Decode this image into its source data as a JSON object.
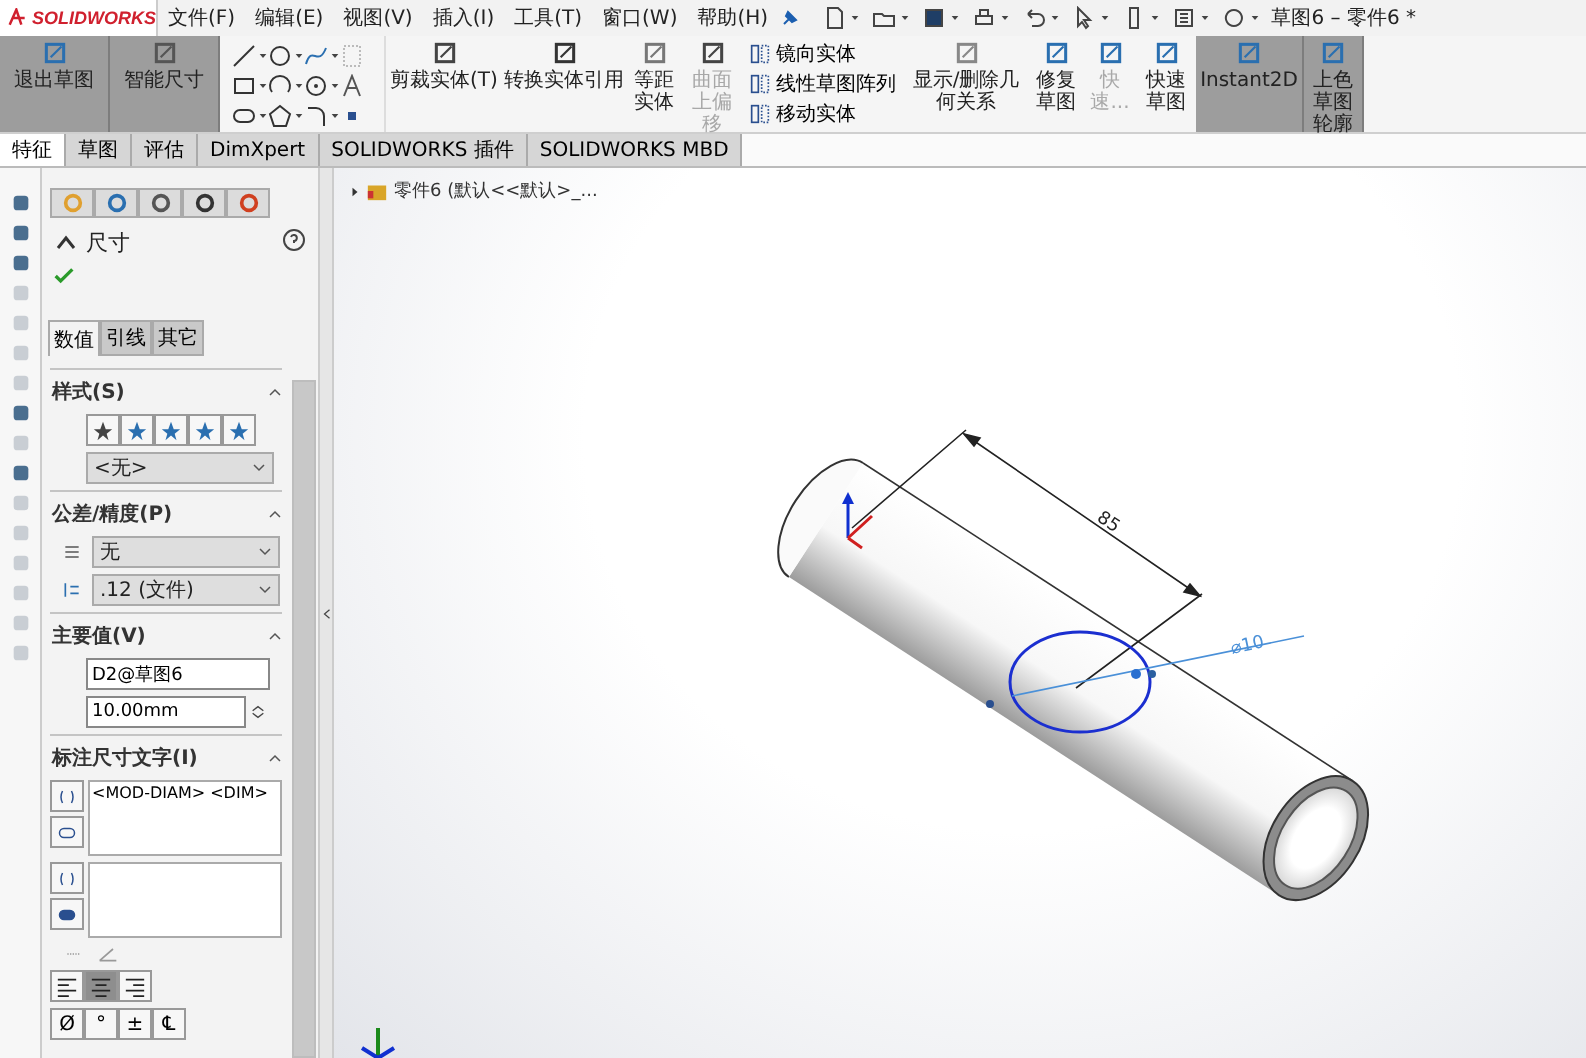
{
  "app": {
    "logo": "SOLIDWORKS",
    "menu": [
      "文件(F)",
      "编辑(E)",
      "视图(V)",
      "插入(I)",
      "工具(T)",
      "窗口(W)",
      "帮助(H)"
    ],
    "title": "草图6 – 零件6 *"
  },
  "ribbon": [
    {
      "kind": "large",
      "label": "退出草图",
      "selected": true,
      "disabled": false
    },
    {
      "kind": "large",
      "label": "智能尺寸",
      "selected": true,
      "disabled": false
    },
    {
      "kind": "tools"
    },
    {
      "kind": "large",
      "label": "剪裁实体(T)",
      "selected": false,
      "disabled": false
    },
    {
      "kind": "large",
      "label": "转换实体引用",
      "selected": false,
      "disabled": false
    },
    {
      "kind": "large",
      "label": "等距实体",
      "selected": false,
      "disabled": false
    },
    {
      "kind": "large",
      "label": "曲面上偏移",
      "selected": false,
      "disabled": true
    },
    {
      "kind": "stack",
      "items": [
        "镜向实体",
        "线性草图阵列",
        "移动实体"
      ]
    },
    {
      "kind": "large",
      "label": "显示/删除几何关系",
      "selected": false,
      "disabled": false
    },
    {
      "kind": "large",
      "label": "修复草图",
      "selected": false,
      "disabled": false
    },
    {
      "kind": "large",
      "label": "快速...",
      "selected": false,
      "disabled": true
    },
    {
      "kind": "large",
      "label": "快速草图",
      "selected": false,
      "disabled": false
    },
    {
      "kind": "large",
      "label": "Instant2D",
      "selected": true,
      "disabled": false
    },
    {
      "kind": "large",
      "label": "上色草图轮廓",
      "selected": true,
      "disabled": false
    }
  ],
  "tabs": [
    {
      "label": "特征",
      "selected": true
    },
    {
      "label": "草图",
      "selected": false
    },
    {
      "label": "评估",
      "selected": false
    },
    {
      "label": "DimXpert",
      "selected": false
    },
    {
      "label": "SOLIDWORKS 插件",
      "selected": false
    },
    {
      "label": "SOLIDWORKS MBD",
      "selected": false
    }
  ],
  "property_manager": {
    "title": "尺寸",
    "tabs": [
      {
        "label": "数值",
        "selected": true
      },
      {
        "label": "引线",
        "selected": false
      },
      {
        "label": "其它",
        "selected": false
      }
    ],
    "style": {
      "header": "样式(S)",
      "dropdown": "<无>"
    },
    "tolerance": {
      "header": "公差/精度(P)",
      "type": "无",
      "precision": ".12 (文件)"
    },
    "primary": {
      "header": "主要值(V)",
      "name": "D2@草图6",
      "value": "10.00mm"
    },
    "dimension_text": {
      "header": "标注尺寸文字(I)",
      "text": "<MOD-DIAM> <DIM>",
      "alignment": [
        {
          "selected": false
        },
        {
          "selected": true
        },
        {
          "selected": false
        }
      ],
      "symbols": [
        "Ø",
        "°",
        "±",
        "℄"
      ]
    }
  },
  "viewport": {
    "tree_item": "零件6 (默认<<默认>_...",
    "dimension": "85",
    "diameter": "⌀10"
  }
}
